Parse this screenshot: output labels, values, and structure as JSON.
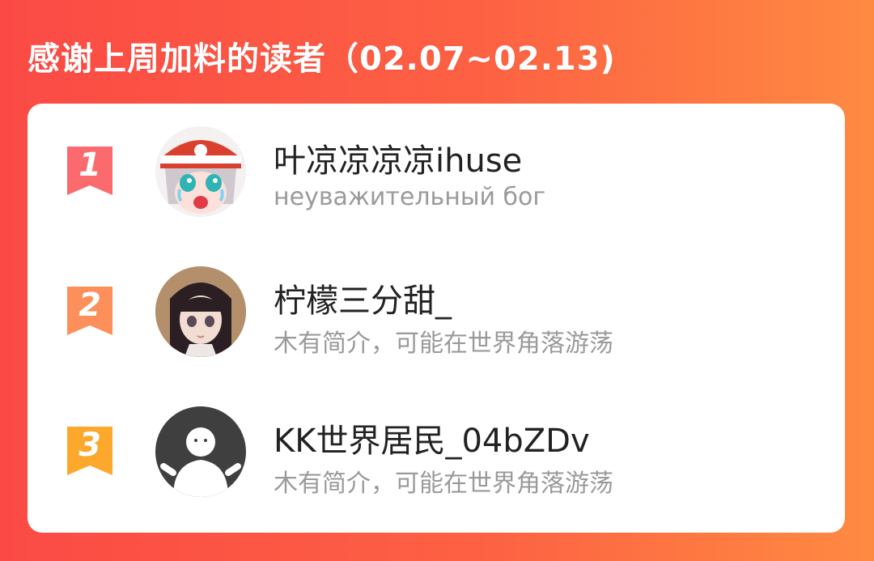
{
  "header": {
    "title": "感谢上周加料的读者（02.07~02.13)"
  },
  "colors": {
    "background_start": "#fb4a45",
    "background_end": "#fe8a42",
    "rank_1": "#fb6b6e",
    "rank_2": "#fd8f5a",
    "rank_3": "#fca82c",
    "name_text": "#222222",
    "bio_text": "#9a9a9a"
  },
  "readers": [
    {
      "rank": "1",
      "name": "叶凉凉凉凉ihuse",
      "bio": "неуважительный бог",
      "avatar": "anime-crying-girl-avatar"
    },
    {
      "rank": "2",
      "name": "柠檬三分甜_",
      "bio": "木有简介，可能在世界角落游荡",
      "avatar": "anime-dark-hair-girl-avatar"
    },
    {
      "rank": "3",
      "name": "KK世界居民_04bZDv",
      "bio": "木有简介，可能在世界角落游荡",
      "avatar": "default-user-avatar"
    }
  ]
}
